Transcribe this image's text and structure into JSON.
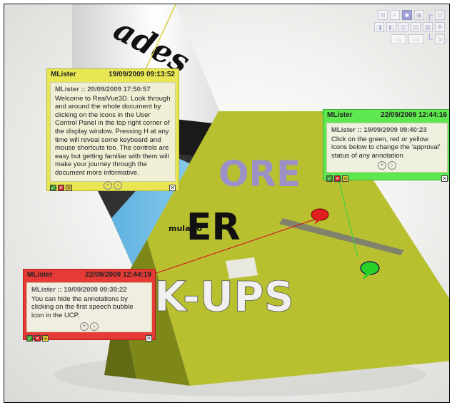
{
  "ucp": {
    "row1": [
      "⊞",
      "✓",
      "■",
      "▣",
      "⊡"
    ],
    "row2": [
      "◨",
      "◧",
      "▥",
      "▤",
      "▦",
      "✥"
    ],
    "row3": [
      "▭",
      "▭",
      "▭",
      "⇲"
    ]
  },
  "notes": [
    {
      "id": "yellow",
      "author": "MLister",
      "date": "19/09/2009 09:13:52",
      "meta": "MLister :: 20/09/2009 17:50:57",
      "text": "Welcome to RealVue3D. Look through and around the whole document by clicking on the icons in the User Control Panel in the top right corner of the display window. Pressing H at any time will reveal some keyboard and mouse shortcuts too. The controls are easy but getting familiar with them will make your journey through the document more informative."
    },
    {
      "id": "green",
      "author": "MLister",
      "date": "22/09/2009 12:44:16",
      "meta": "MLister :: 19/09/2009 09:40:23",
      "text": "Click on the green, red or yellow icons below to change the 'approval' status of any annotation"
    },
    {
      "id": "red",
      "author": "MLister",
      "date": "22/09/2009 12:44:19",
      "meta": "MLister :: 19/09/2009 09:39:22",
      "text": "You can hide the annotations by clicking on the first speech bubble icon in the UCP."
    }
  ],
  "scene": {
    "poster_words": [
      "ORE",
      "ER",
      "K-UPS"
    ],
    "poster_small": "mulatio",
    "cylinder_text": "ades",
    "colors": {
      "poster": "#b8c030",
      "poster_side": "#7e8818",
      "cyan": "#70c0e8"
    }
  },
  "icons": {
    "approve": "check-icon",
    "reject": "x-icon",
    "pending": "note-icon",
    "close": "close-icon"
  }
}
